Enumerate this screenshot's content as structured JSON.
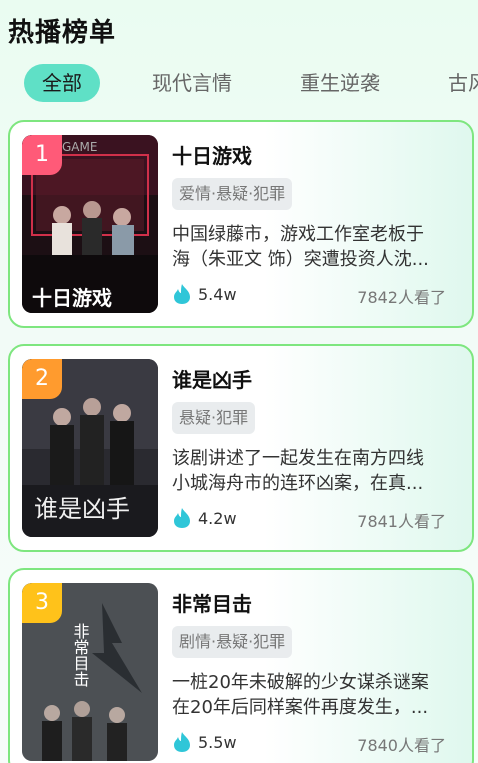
{
  "page": {
    "title": "热播榜单"
  },
  "tabs": [
    {
      "label": "全部",
      "active": true
    },
    {
      "label": "现代言情",
      "active": false
    },
    {
      "label": "重生逆袭",
      "active": false
    },
    {
      "label": "古风",
      "active": false
    }
  ],
  "cards": [
    {
      "rank": "1",
      "rank_color": "#ff5a78",
      "title": "十日游戏",
      "genre": "爱情·悬疑·犯罪",
      "desc_line1": "中国绿藤市，游戏工作室老板于",
      "desc_line2": "海（朱亚文 饰）突遭投资人沈...",
      "heat": "5.4w",
      "views": "7842人看了",
      "poster_text": "十日游戏",
      "poster_banner": "GAME"
    },
    {
      "rank": "2",
      "rank_color": "#ff9b2e",
      "title": "谁是凶手",
      "genre": "悬疑·犯罪",
      "desc_line1": "该剧讲述了一起发生在南方四线",
      "desc_line2": "小城海舟市的连环凶案，在真...",
      "heat": "4.2w",
      "views": "7841人看了",
      "poster_text": "谁是凶手"
    },
    {
      "rank": "3",
      "rank_color": "#ffc21a",
      "title": "非常目击",
      "genre": "剧情·悬疑·犯罪",
      "desc_line1": "一桩20年未破解的少女谋杀谜案",
      "desc_line2": "在20年后同样案件再度发生，...",
      "heat": "5.5w",
      "views": "7840人看了",
      "poster_text": "非常目击"
    }
  ],
  "colors": {
    "accent": "#5fe0c6",
    "card_border": "#7ee67f",
    "heat_icon": "#2fc6d8"
  }
}
